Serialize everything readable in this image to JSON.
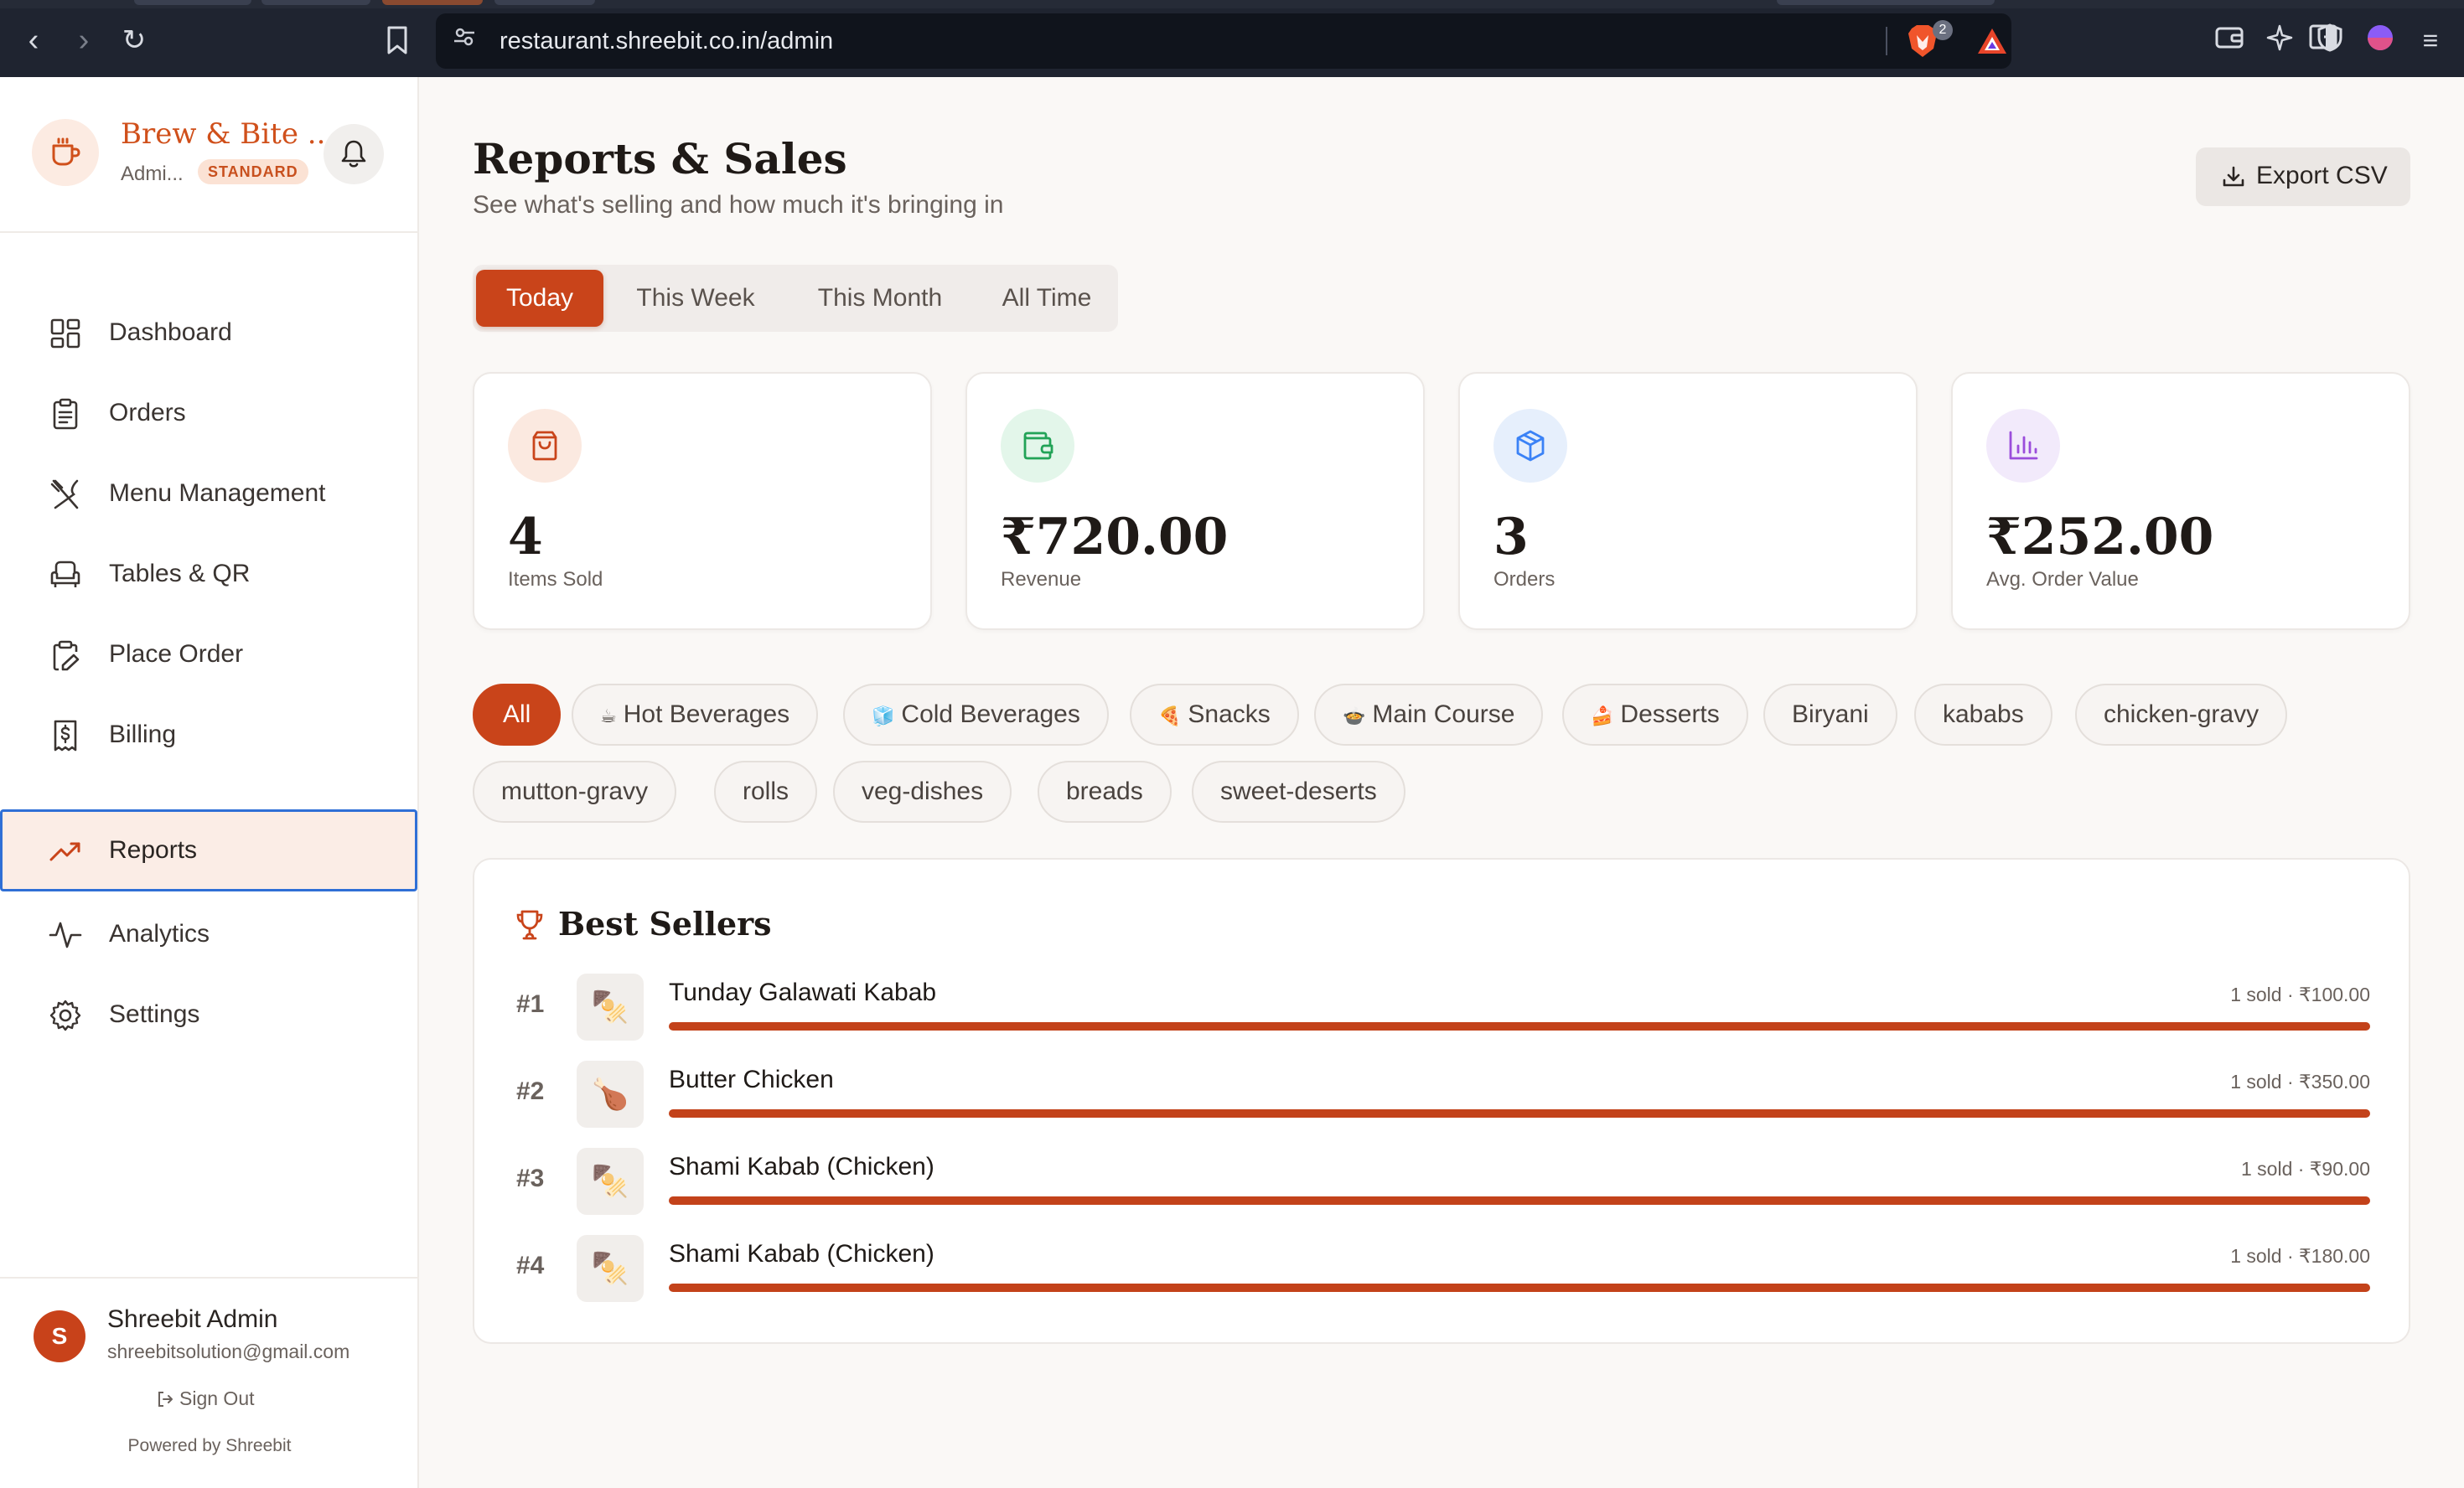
{
  "browser": {
    "url": "restaurant.shreebit.co.in/admin",
    "shield_count": "2"
  },
  "sidebar": {
    "brand_name": "Brew & Bite ...",
    "role": "Admi...",
    "plan": "STANDARD",
    "items": [
      {
        "label": "Dashboard",
        "icon": "grid-icon"
      },
      {
        "label": "Orders",
        "icon": "clipboard-icon"
      },
      {
        "label": "Menu Management",
        "icon": "utensils-icon"
      },
      {
        "label": "Tables & QR",
        "icon": "armchair-icon"
      },
      {
        "label": "Place Order",
        "icon": "clipboard-pen-icon"
      },
      {
        "label": "Billing",
        "icon": "receipt-icon"
      },
      {
        "label": "Reports",
        "icon": "trending-up-icon",
        "active": true
      },
      {
        "label": "Analytics",
        "icon": "activity-icon"
      },
      {
        "label": "Settings",
        "icon": "gear-icon"
      }
    ],
    "user": {
      "initial": "S",
      "name": "Shreebit Admin",
      "email": "shreebitsolution@gmail.com"
    },
    "sign_out": "Sign Out",
    "powered_by": "Powered by Shreebit"
  },
  "header": {
    "title": "Reports & Sales",
    "subtitle": "See what's selling and how much it's bringing in",
    "export_label": "Export CSV"
  },
  "period_tabs": [
    {
      "label": "Today",
      "active": true
    },
    {
      "label": "This Week"
    },
    {
      "label": "This Month"
    },
    {
      "label": "All Time"
    }
  ],
  "stats": [
    {
      "value": "4",
      "caption": "Items Sold",
      "icon": "shopping-bag-icon",
      "tint": "#fbe9e0",
      "color": "#c9441a"
    },
    {
      "value": "₹720.00",
      "caption": "Revenue",
      "icon": "wallet-icon",
      "tint": "#e3f6ea",
      "color": "#22a357"
    },
    {
      "value": "3",
      "caption": "Orders",
      "icon": "package-icon",
      "tint": "#e6effc",
      "color": "#3b82f6"
    },
    {
      "value": "₹252.00",
      "caption": "Avg. Order Value",
      "icon": "bar-chart-icon",
      "tint": "#f2eafb",
      "color": "#9b4ddb"
    }
  ],
  "categories": [
    {
      "label": "All",
      "active": true
    },
    {
      "label": "Hot Beverages",
      "emoji": "☕"
    },
    {
      "label": "Cold Beverages",
      "emoji": "🧊"
    },
    {
      "label": "Snacks",
      "emoji": "🍕"
    },
    {
      "label": "Main Course",
      "emoji": "🍲"
    },
    {
      "label": "Desserts",
      "emoji": "🍰"
    },
    {
      "label": "Biryani"
    },
    {
      "label": "kababs"
    },
    {
      "label": "chicken-gravy"
    },
    {
      "label": "mutton-gravy"
    },
    {
      "label": "rolls"
    },
    {
      "label": "veg-dishes"
    },
    {
      "label": "breads"
    },
    {
      "label": "sweet-deserts"
    }
  ],
  "best_sellers": {
    "title": "Best Sellers",
    "items": [
      {
        "rank": "#1",
        "name": "Tunday Galawati Kabab",
        "meta": "1 sold · ₹100.00",
        "emoji": "🍢",
        "fill": 1.0
      },
      {
        "rank": "#2",
        "name": "Butter Chicken",
        "meta": "1 sold · ₹350.00",
        "emoji": "🍗",
        "fill": 1.0
      },
      {
        "rank": "#3",
        "name": "Shami Kabab (Chicken)",
        "meta": "1 sold · ₹90.00",
        "emoji": "🍢",
        "fill": 1.0
      },
      {
        "rank": "#4",
        "name": "Shami Kabab (Chicken)",
        "meta": "1 sold · ₹180.00",
        "emoji": "🍢",
        "fill": 1.0
      }
    ]
  }
}
